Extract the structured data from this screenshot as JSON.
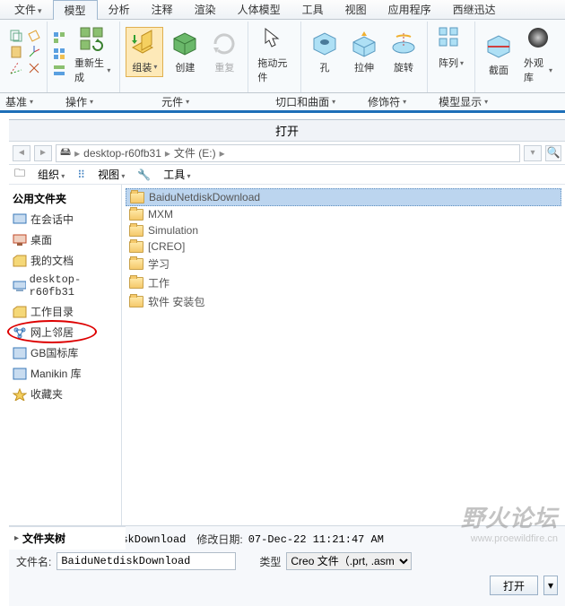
{
  "menubar": {
    "items": [
      {
        "label": "文件",
        "dd": true
      },
      {
        "label": "模型",
        "active": true
      },
      {
        "label": "分析"
      },
      {
        "label": "注释"
      },
      {
        "label": "渲染"
      },
      {
        "label": "人体模型"
      },
      {
        "label": "工具"
      },
      {
        "label": "视图"
      },
      {
        "label": "应用程序"
      },
      {
        "label": "西继迅达"
      }
    ]
  },
  "ribbon": {
    "groups": [
      {
        "label": "重新生成",
        "dd": true
      },
      {
        "label": "组装",
        "sel": true,
        "dd": true
      },
      {
        "label": "创建"
      },
      {
        "label": "重复"
      },
      {
        "label": "拖动元件"
      },
      {
        "label": "孔"
      },
      {
        "label": "拉伸"
      },
      {
        "label": "旋转"
      },
      {
        "label": "阵列",
        "dd": true
      },
      {
        "label": "截面"
      },
      {
        "label": "外观库",
        "dd": true
      }
    ]
  },
  "subbar": {
    "items": [
      "基准",
      "操作",
      "元件",
      "切口和曲面",
      "修饰符",
      "模型显示"
    ]
  },
  "dialog": {
    "title": "打开",
    "breadcrumb": {
      "host": "desktop-r60fb31",
      "drive": "文件 (E:)"
    },
    "toolbar": {
      "organize": "组织",
      "view": "视图",
      "tools": "工具"
    },
    "sidebar": {
      "header": "公用文件夹",
      "items": [
        {
          "label": "在会话中",
          "color": "#3a78b8"
        },
        {
          "label": "桌面",
          "color": "#c04a2a"
        },
        {
          "label": "我的文档",
          "color": "#d8a030"
        },
        {
          "label": "desktop-r60fb31",
          "color": "#3a78b8",
          "mono": true
        },
        {
          "label": "工作目录",
          "color": "#d8a030"
        },
        {
          "label": "网上邻居",
          "color": "#3a78b8",
          "circled": true
        },
        {
          "label": "GB国标库",
          "color": "#3a78b8"
        },
        {
          "label": "Manikin 库",
          "color": "#3a78b8"
        },
        {
          "label": "收藏夹",
          "color": "#d8a030"
        }
      ]
    },
    "files": [
      {
        "name": "BaiduNetdiskDownload",
        "sel": true
      },
      {
        "name": "MXM"
      },
      {
        "name": "Simulation"
      },
      {
        "name": "[CREO]"
      },
      {
        "name": "学习"
      },
      {
        "name": "工作"
      },
      {
        "name": "软件 安装包"
      }
    ],
    "footer": {
      "fname_label": "文件名:",
      "fname_value": "BaiduNetdiskDownload",
      "mdate_label": "修改日期:",
      "mdate_value": "07-Dec-22 11:21:47 AM",
      "type_label": "类型",
      "type_value": "Creo 文件（.prt, .asm 等类型",
      "open_btn": "打开"
    },
    "tree_footer": "文件夹树"
  },
  "watermark": {
    "big": "野火论坛",
    "url": "www.proewildfire.cn"
  }
}
